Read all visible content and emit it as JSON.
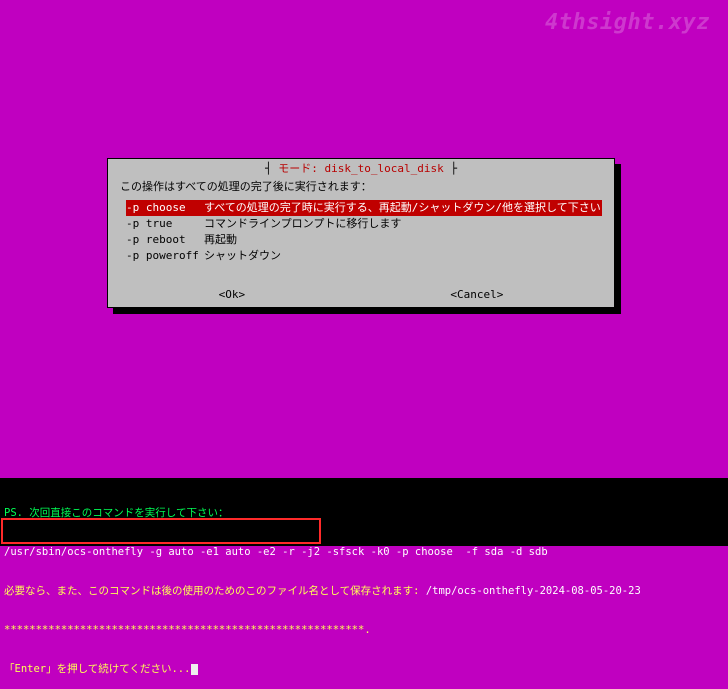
{
  "watermark": "4thsight.xyz",
  "dialog": {
    "title": "モード: disk_to_local_disk",
    "prompt": "この操作はすべての処理の完了後に実行されます：",
    "options": [
      {
        "flag": "-p choose",
        "desc": "すべての処理の完了時に実行する、再起動/シャットダウン/他を選択して下さい",
        "selected": true
      },
      {
        "flag": "-p true",
        "desc": "コマンドラインプロンプトに移行します",
        "selected": false
      },
      {
        "flag": "-p reboot",
        "desc": "再起動",
        "selected": false
      },
      {
        "flag": "-p poweroff",
        "desc": "シャットダウン",
        "selected": false
      }
    ],
    "ok_label": "<Ok>",
    "cancel_label": "<Cancel>"
  },
  "terminal": {
    "line1": "PS. 次回直接このコマンドを実行して下さい：",
    "line2": "/usr/sbin/ocs-onthefly -g auto -e1 auto -e2 -r -j2 -sfsck -k0 -p choose  -f sda -d sdb",
    "line3a": "必要なら、また、このコマンドは後の使用のためのこのファ",
    "line3b": "イル名として保存されます: ",
    "line3c": "/tmp/ocs-onthefly-2024-08-05-20-23",
    "line4": "*********************************************************.",
    "line5": "「Enter」を押して続けてください..."
  }
}
